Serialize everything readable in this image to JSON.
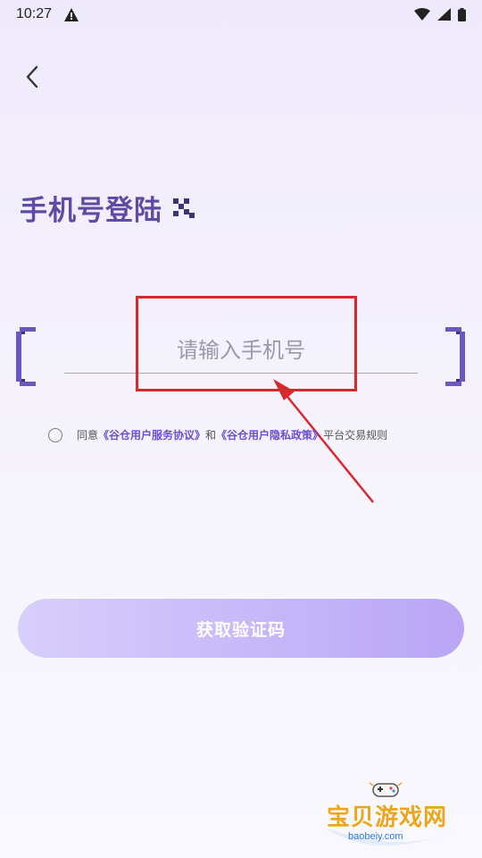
{
  "status_bar": {
    "time": "10:27"
  },
  "header": {
    "back_icon": "chevron-left-icon"
  },
  "login": {
    "title": "手机号登陆",
    "phone_placeholder": "请输入手机号",
    "phone_value": ""
  },
  "agreement": {
    "prefix": "同意",
    "link_service": "《谷仓用户服务协议》",
    "connector": "和",
    "link_privacy": "《谷仓用户隐私政策》",
    "suffix": "平台交易规则",
    "checked": false
  },
  "actions": {
    "get_code_label": "获取验证码"
  },
  "watermark": {
    "brand": "宝贝游戏网",
    "url": "baobeiy.com"
  },
  "colors": {
    "title": "#5f4aa6",
    "link": "#6a4fd6",
    "button_start": "#d8cffb",
    "button_end": "#b9a6f5",
    "highlight": "#d9282c"
  }
}
